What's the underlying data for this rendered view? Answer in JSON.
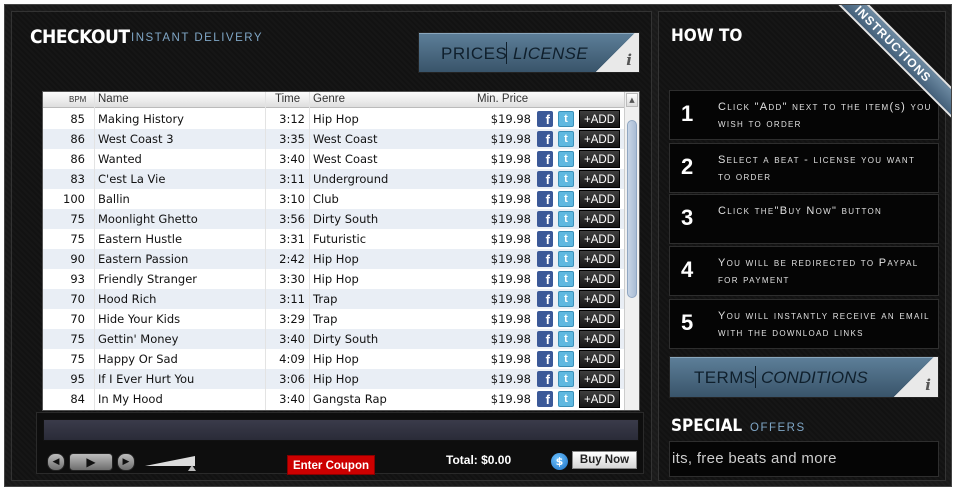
{
  "checkout": {
    "title": "CHECKOUT",
    "subtitle": "INSTANT DELIVERY"
  },
  "prices_license": {
    "prices": "PRICES",
    "license": "LICENSE",
    "info": "i"
  },
  "table": {
    "headers": {
      "bpm": "BPM",
      "name": "Name",
      "time": "Time",
      "genre": "Genre",
      "price": "Min. Price"
    },
    "rows": [
      {
        "bpm": "85",
        "name": "Making History",
        "time": "3:12",
        "genre": "Hip Hop",
        "price": "$19.98"
      },
      {
        "bpm": "86",
        "name": "West Coast 3",
        "time": "3:35",
        "genre": "West Coast",
        "price": "$19.98"
      },
      {
        "bpm": "86",
        "name": "Wanted",
        "time": "3:40",
        "genre": "West Coast",
        "price": "$19.98"
      },
      {
        "bpm": "83",
        "name": "C'est La Vie",
        "time": "3:11",
        "genre": "Underground",
        "price": "$19.98"
      },
      {
        "bpm": "100",
        "name": "Ballin",
        "time": "3:10",
        "genre": "Club",
        "price": "$19.98"
      },
      {
        "bpm": "75",
        "name": "Moonlight Ghetto",
        "time": "3:56",
        "genre": "Dirty South",
        "price": "$19.98"
      },
      {
        "bpm": "75",
        "name": "Eastern Hustle",
        "time": "3:31",
        "genre": "Futuristic",
        "price": "$19.98"
      },
      {
        "bpm": "90",
        "name": "Eastern Passion",
        "time": "2:42",
        "genre": "Hip Hop",
        "price": "$19.98"
      },
      {
        "bpm": "93",
        "name": "Friendly Stranger",
        "time": "3:30",
        "genre": "Hip Hop",
        "price": "$19.98"
      },
      {
        "bpm": "70",
        "name": "Hood Rich",
        "time": "3:11",
        "genre": "Trap",
        "price": "$19.98"
      },
      {
        "bpm": "70",
        "name": "Hide Your Kids",
        "time": "3:29",
        "genre": "Trap",
        "price": "$19.98"
      },
      {
        "bpm": "75",
        "name": "Gettin' Money",
        "time": "3:40",
        "genre": "Dirty South",
        "price": "$19.98"
      },
      {
        "bpm": "75",
        "name": "Happy Or Sad",
        "time": "4:09",
        "genre": "Hip Hop",
        "price": "$19.98"
      },
      {
        "bpm": "95",
        "name": "If I Ever Hurt You",
        "time": "3:06",
        "genre": "Hip Hop",
        "price": "$19.98"
      },
      {
        "bpm": "84",
        "name": "In My Hood",
        "time": "3:40",
        "genre": "Gangsta Rap",
        "price": "$19.98"
      }
    ],
    "facebook_glyph": "f",
    "twitter_glyph": "t",
    "add_label": "+ADD"
  },
  "player": {
    "prev_glyph": "◀",
    "play_glyph": "▶",
    "next_glyph": "▶",
    "coupon_label": "Enter Coupon",
    "total_label": "Total: $0.00",
    "paypal_glyph": "$",
    "buy_now_label": "Buy Now"
  },
  "howto": {
    "title": "HOW TO",
    "steps": [
      {
        "num": "1",
        "text": "Click \"Add\" next to the item(s) you wish to order"
      },
      {
        "num": "2",
        "text": "Select a beat - license you want to order"
      },
      {
        "num": "3",
        "text": "Click the\"Buy Now\" button"
      },
      {
        "num": "4",
        "text": "You will be redirected to Paypal for payment"
      },
      {
        "num": "5",
        "text": "You will instantly receive an email with the download links"
      }
    ]
  },
  "terms": {
    "terms": "TERMS",
    "conditions": "CONDITIONS",
    "info": "i"
  },
  "special": {
    "title": "SPECIAL",
    "subtitle": "OFFERS",
    "ticker": "its, free beats and more"
  },
  "ribbon": {
    "label": "INSTRUCTIONS"
  },
  "colors": {
    "accent": "#7fa6c6",
    "button_blue": "#4a6a82",
    "coupon_red": "#cc0000",
    "facebook": "#3b5998",
    "twitter": "#5fb8e0"
  }
}
